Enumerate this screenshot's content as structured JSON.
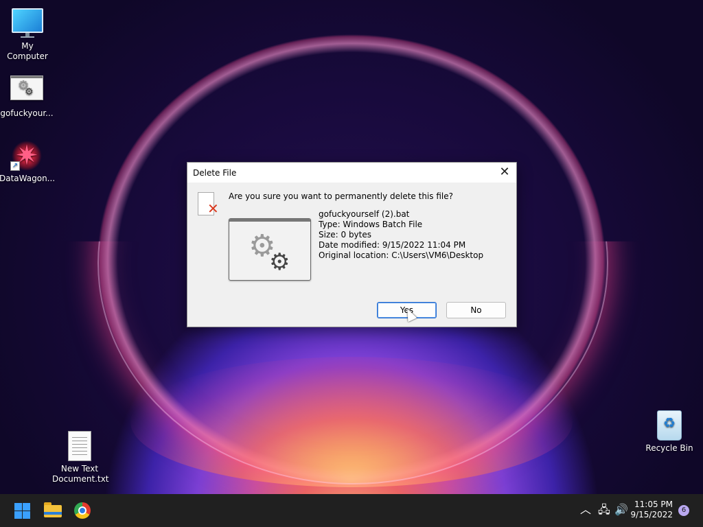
{
  "desktop": {
    "icons": [
      {
        "label": "My Computer"
      },
      {
        "label": "gofuckyour..."
      },
      {
        "label": "DataWagon..."
      },
      {
        "label": "New Text\nDocument.txt"
      },
      {
        "label": "Recycle Bin"
      }
    ]
  },
  "dialog": {
    "title": "Delete File",
    "question": "Are you sure you want to permanently delete this file?",
    "file": {
      "name": "gofuckyourself (2).bat",
      "type": "Type: Windows Batch File",
      "size": "Size: 0 bytes",
      "modified": "Date modified: 9/15/2022 11:04 PM",
      "location": "Original location: C:\\Users\\VM6\\Desktop"
    },
    "yes_label": "Yes",
    "no_label": "No"
  },
  "taskbar": {
    "time": "11:05 PM",
    "date": "9/15/2022",
    "notification_count": "6"
  }
}
